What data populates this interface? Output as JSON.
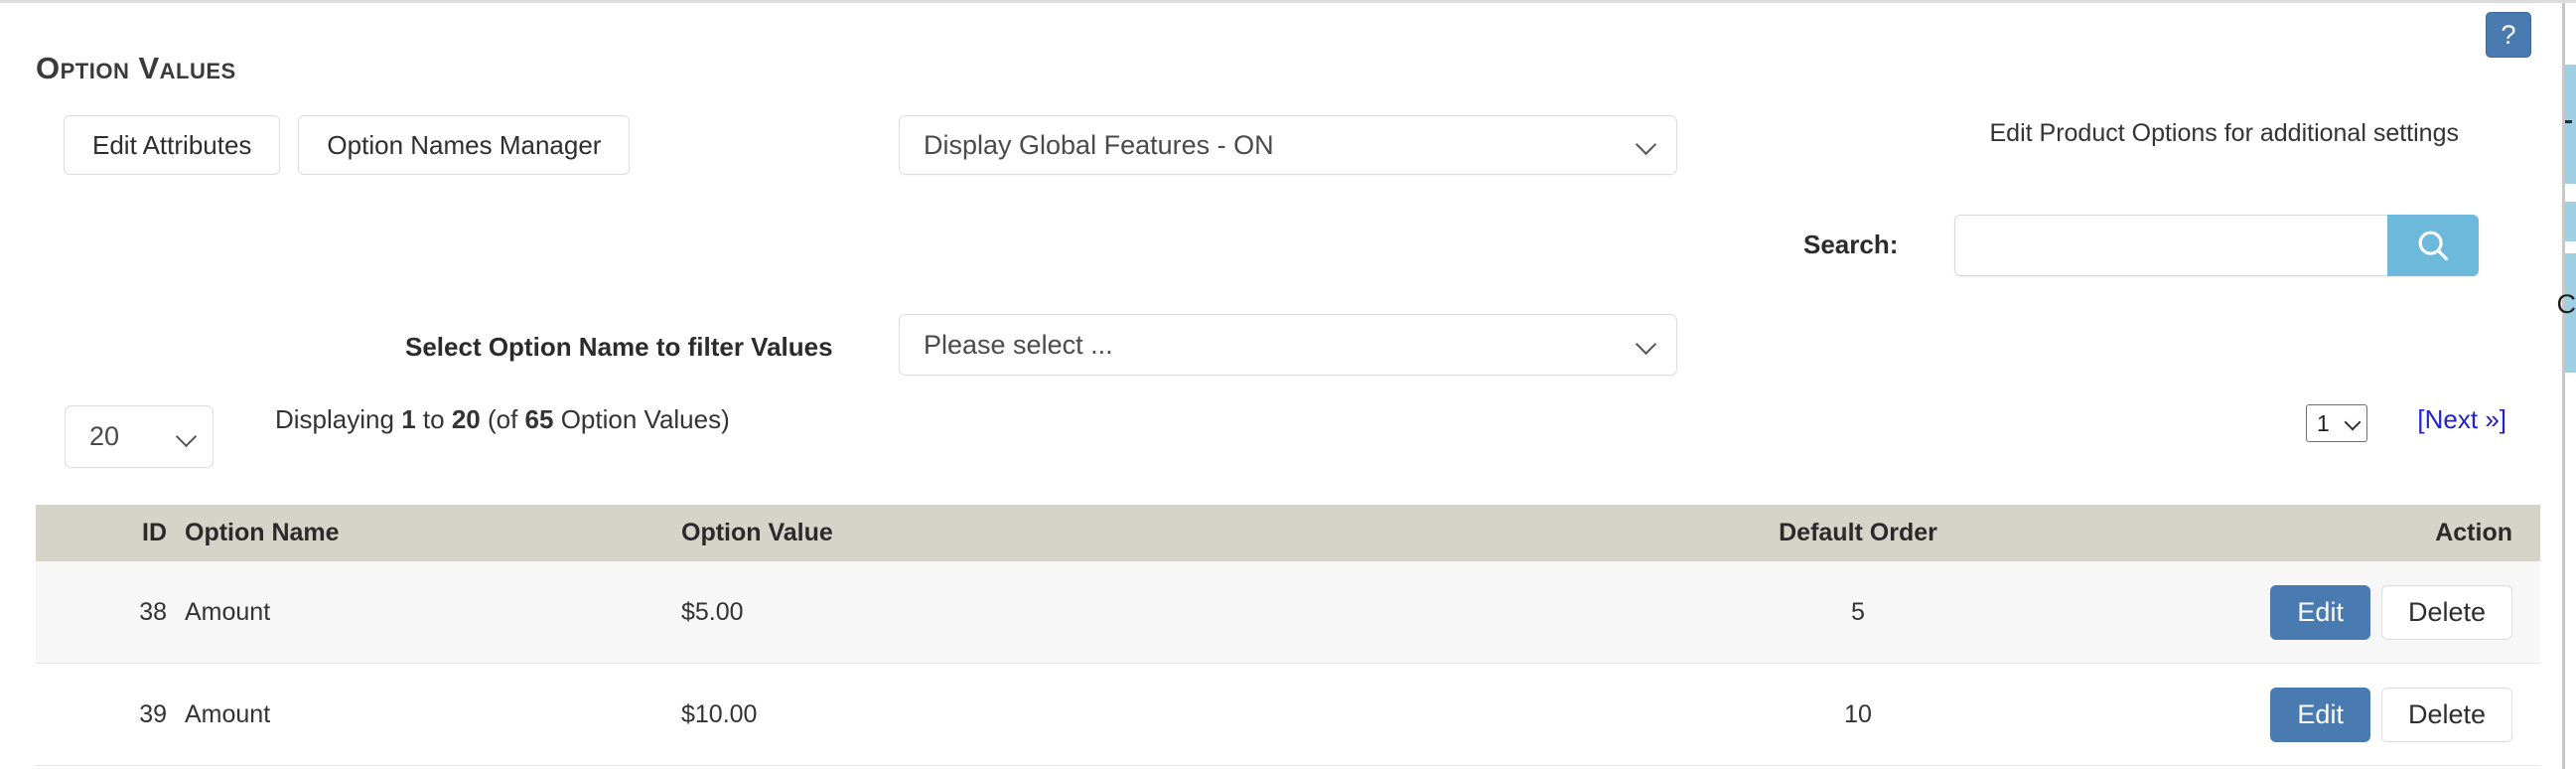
{
  "page": {
    "title": "Option Values"
  },
  "help": {
    "label": "?",
    "icon": "question-mark-icon",
    "color": "#4a7bb0"
  },
  "toolbar": {
    "edit_attributes_label": "Edit Attributes",
    "option_names_manager_label": "Option Names Manager",
    "global_features_select": {
      "value": "Display Global Features - ON",
      "icon": "chevron-down-icon"
    },
    "helper_text": "Edit Product Options for additional settings"
  },
  "search": {
    "label": "Search:",
    "value": "",
    "placeholder": "",
    "button_icon": "search-icon",
    "button_color": "#6cb9dc"
  },
  "filter": {
    "label": "Select Option Name to filter Values",
    "select": {
      "value": "Please select ...",
      "icon": "chevron-down-icon"
    }
  },
  "pagination": {
    "per_page": "20",
    "displaying_prefix": "Displaying",
    "from": "1",
    "to_word": "to",
    "to": "20",
    "of_open": "(of",
    "total": "65",
    "of_close": "Option Values)",
    "current_page": "1",
    "next_label": "[Next »]"
  },
  "table": {
    "columns": [
      {
        "key": "id",
        "label": "ID"
      },
      {
        "key": "option_name",
        "label": "Option Name"
      },
      {
        "key": "option_value",
        "label": "Option Value"
      },
      {
        "key": "default_order",
        "label": "Default Order"
      },
      {
        "key": "action",
        "label": "Action"
      }
    ],
    "header_color": "#d6d4c9",
    "rows": [
      {
        "id": "38",
        "option_name": "Amount",
        "option_value": "$5.00",
        "default_order": "5",
        "edit_label": "Edit",
        "delete_label": "Delete"
      },
      {
        "id": "39",
        "option_name": "Amount",
        "option_value": "$10.00",
        "default_order": "10",
        "edit_label": "Edit",
        "delete_label": "Delete"
      }
    ]
  }
}
